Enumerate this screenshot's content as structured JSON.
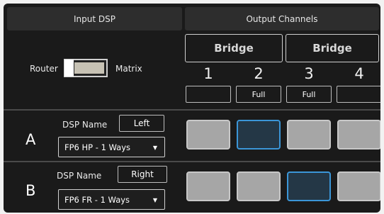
{
  "header": {
    "input_dsp": "Input DSP",
    "output_channels": "Output Channels"
  },
  "bridges": [
    "Bridge",
    "Bridge"
  ],
  "channels": [
    {
      "number": "1",
      "mode": ""
    },
    {
      "number": "2",
      "mode": "Full"
    },
    {
      "number": "3",
      "mode": "Full"
    },
    {
      "number": "4",
      "mode": ""
    }
  ],
  "routing_toggle": {
    "left_label": "Router",
    "right_label": "Matrix",
    "state": "Router"
  },
  "rows": [
    {
      "letter": "A",
      "dsp_name_label": "DSP Name",
      "dsp_name": "Left",
      "preset": "FP6 HP - 1 Ways",
      "selected_channels": [
        2
      ]
    },
    {
      "letter": "B",
      "dsp_name_label": "DSP Name",
      "dsp_name": "Right",
      "preset": "FP6 FR - 1 Ways",
      "selected_channels": [
        3
      ]
    }
  ],
  "colors": {
    "background": "#1a1a1a",
    "cell_off": "#a6a6a6",
    "cell_on_fill": "#243746",
    "cell_on_border": "#3b96d8"
  },
  "icons": {
    "dropdown": "chevron-down-icon"
  }
}
